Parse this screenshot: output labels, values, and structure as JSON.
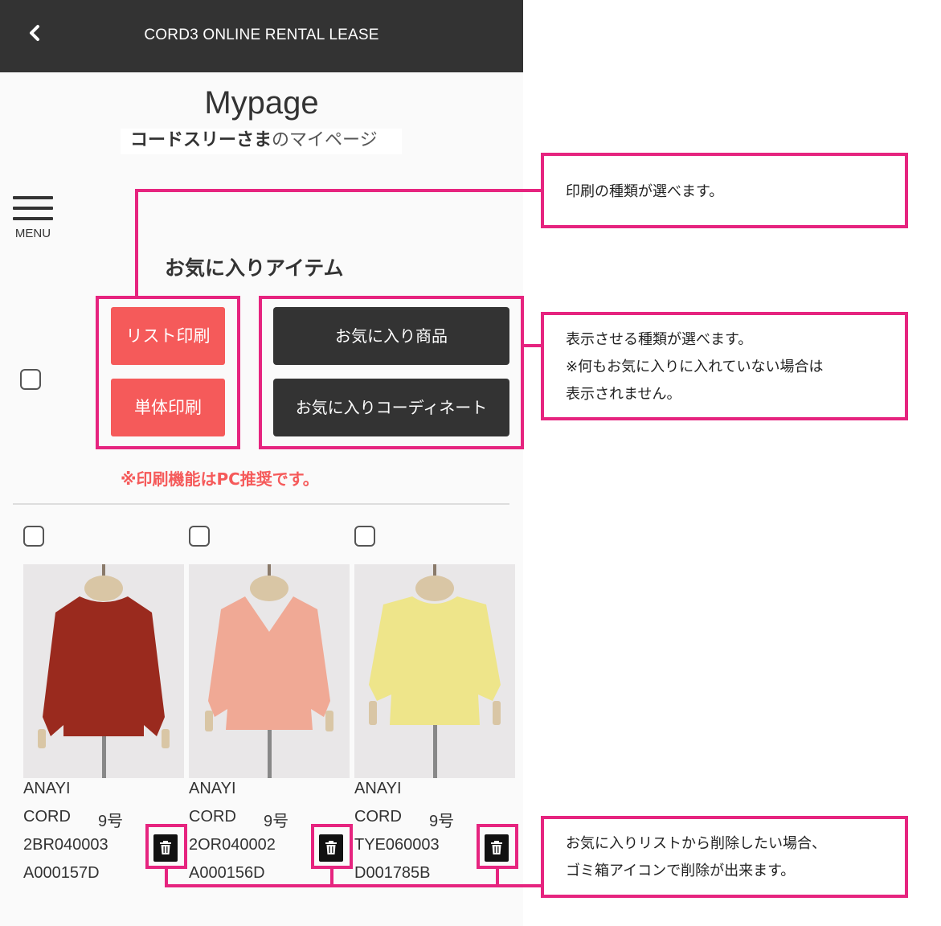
{
  "topbar": {
    "back_icon": "chevron-left-icon",
    "title": "CORD3 ONLINE RENTAL LEASE"
  },
  "page": {
    "title": "Mypage",
    "user_name": "コードスリーさま",
    "user_suffix": "のマイページ"
  },
  "menu": {
    "label": "MENU",
    "icon": "hamburger-icon"
  },
  "favorites": {
    "heading": "お気に入りアイテム",
    "print_buttons": {
      "list": "リスト印刷",
      "single": "単体印刷"
    },
    "view_buttons": {
      "items": "お気に入り商品",
      "coordinates": "お気に入りコーディネート"
    },
    "print_note": "※印刷機能はPC推奨です。",
    "items": [
      {
        "brand": "ANAYI",
        "label": "CORD",
        "size": "9号",
        "code": "2BR040003",
        "id": "A000157D",
        "color": "#9a2a1e"
      },
      {
        "brand": "ANAYI",
        "label": "CORD",
        "size": "9号",
        "code": "2OR040002",
        "id": "A000156D",
        "color": "#f0a995"
      },
      {
        "brand": "ANAYI",
        "label": "CORD",
        "size": "9号",
        "code": "TYE060003",
        "id": "D001785B",
        "color": "#eee58a"
      }
    ]
  },
  "annotations": {
    "print_type": "印刷の種類が選べます。",
    "view_type": [
      "表示させる種類が選べます。",
      "※何もお気に入りに入れていない場合は",
      "表示されません。"
    ],
    "delete": [
      "お気に入りリストから削除したい場合、",
      "ゴミ箱アイコンで削除が出来ます。"
    ]
  },
  "colors": {
    "accent_red": "#f55a5a",
    "dark": "#333333",
    "highlight": "#e6247f"
  }
}
